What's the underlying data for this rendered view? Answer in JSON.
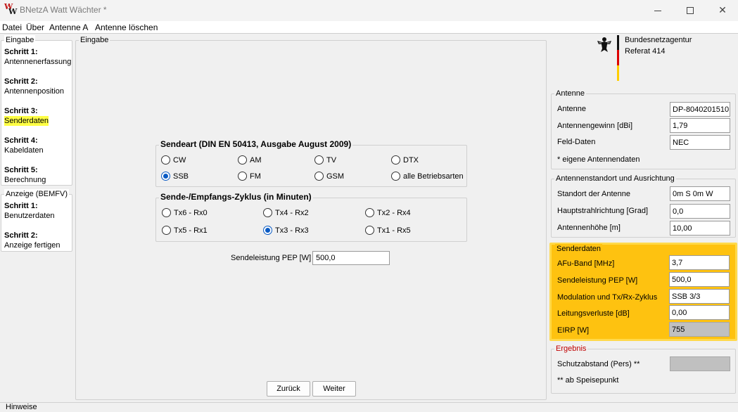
{
  "window": {
    "title": "BNetzA Watt Wächter *",
    "icon_text_1": "W",
    "icon_text_2": "W"
  },
  "menu": [
    "Datei",
    "Über",
    "Antenne A",
    "Antenne löschen"
  ],
  "nav": {
    "eingabe_legend": "Eingabe",
    "eingabe_steps": [
      {
        "head": "Schritt 1:",
        "sub": "Antennenerfassung"
      },
      {
        "head": "Schritt 2:",
        "sub": "Antennenposition"
      },
      {
        "head": "Schritt 3:",
        "sub": "Senderdaten"
      },
      {
        "head": "Schritt 4:",
        "sub": "Kabeldaten"
      },
      {
        "head": "Schritt 5:",
        "sub": "Berechnung"
      }
    ],
    "anzeige_legend": "Anzeige (BEMFV)",
    "anzeige_steps": [
      {
        "head": "Schritt 1:",
        "sub": "Benutzerdaten"
      },
      {
        "head": "Schritt 2:",
        "sub": "Anzeige fertigen"
      }
    ],
    "active_color": "#ffff44"
  },
  "main": {
    "legend": "Eingabe",
    "sendeart": {
      "legend": "Sendeart (DIN EN 50413, Ausgabe August 2009)",
      "options": [
        "CW",
        "AM",
        "TV",
        "DTX",
        "SSB",
        "FM",
        "GSM",
        "alle Betriebsarten"
      ],
      "selected": "SSB"
    },
    "zyklus": {
      "legend": "Sende-/Empfangs-Zyklus (in Minuten)",
      "options": [
        "Tx6 - Rx0",
        "Tx4 - Rx2",
        "Tx2 - Rx4",
        "Tx5 - Rx1",
        "Tx3 - Rx3",
        "Tx1 - Rx5"
      ],
      "selected": "Tx3 - Rx3"
    },
    "sendeleistung_label": "Sendeleistung PEP [W]",
    "sendeleistung_value": "500,0",
    "back_label": "Zurück",
    "next_label": "Weiter"
  },
  "logo": {
    "line1": "Bundesnetzagentur",
    "line2": "Referat 414"
  },
  "antenne": {
    "legend": "Antenne",
    "rows": [
      {
        "label": "Antenne",
        "value": "DP-8040201510"
      },
      {
        "label": "Antennengewinn [dBi]",
        "value": "1,79"
      },
      {
        "label": "Feld-Daten",
        "value": "NEC"
      }
    ],
    "note": "* eigene Antennendaten"
  },
  "standort": {
    "legend": "Antennenstandort und Ausrichtung",
    "rows": [
      {
        "label": "Standort der Antenne",
        "value": "0m S 0m W"
      },
      {
        "label": "Hauptstrahlrichtung [Grad]",
        "value": "0,0"
      },
      {
        "label": "Antennenhöhe [m]",
        "value": "10,00"
      }
    ]
  },
  "senderdaten": {
    "legend": "Senderdaten",
    "rows": [
      {
        "label": "AFu-Band [MHz]",
        "value": "3,7"
      },
      {
        "label": "Sendeleistung PEP [W]",
        "value": "500,0"
      },
      {
        "label": "Modulation und Tx/Rx-Zyklus",
        "value": "SSB 3/3"
      },
      {
        "label": "Leitungsverluste [dB]",
        "value": "0,00"
      },
      {
        "label": "EIRP [W]",
        "value": "755"
      }
    ],
    "accent": "#fec210"
  },
  "ergebnis": {
    "legend": "Ergebnis",
    "label": "Schutzabstand (Pers) **",
    "value": "",
    "note": "** ab Speisepunkt",
    "legend_color": "#c00000"
  },
  "footer": {
    "hinweise": "Hinweise"
  }
}
